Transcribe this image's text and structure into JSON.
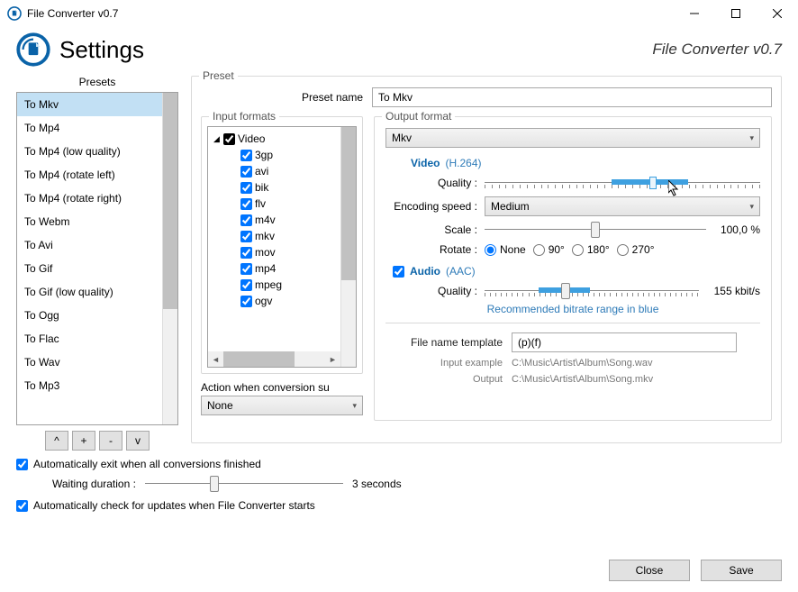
{
  "titlebar": {
    "title": "File Converter v0.7"
  },
  "header": {
    "title": "Settings",
    "subtitle": "File Converter v0.7"
  },
  "presets": {
    "title": "Presets",
    "items": [
      "To Mkv",
      "To Mp4",
      "To Mp4 (low quality)",
      "To Mp4 (rotate left)",
      "To Mp4 (rotate right)",
      "To Webm",
      "To Avi",
      "To Gif",
      "To Gif (low quality)",
      "To Ogg",
      "To Flac",
      "To Wav",
      "To Mp3"
    ],
    "selected": 0,
    "buttons": {
      "up": "^",
      "add": "+",
      "remove": "-",
      "down": "v"
    }
  },
  "preset": {
    "legend": "Preset",
    "name_label": "Preset name",
    "name_value": "To Mkv",
    "input_formats": {
      "legend": "Input formats",
      "group": "Video",
      "items": [
        "3gp",
        "avi",
        "bik",
        "flv",
        "m4v",
        "mkv",
        "mov",
        "mp4",
        "mpeg",
        "ogv"
      ]
    },
    "action": {
      "label": "Action when conversion su",
      "value": "None"
    },
    "output": {
      "legend": "Output format",
      "format": "Mkv",
      "video": {
        "title": "Video",
        "codec": "(H.264)",
        "quality_label": "Quality :",
        "encoding_label": "Encoding speed :",
        "encoding_value": "Medium",
        "scale_label": "Scale :",
        "scale_value": "100,0 %",
        "rotate_label": "Rotate :",
        "rotate_options": [
          "None",
          "90°",
          "180°",
          "270°"
        ],
        "rotate_selected": 0
      },
      "audio": {
        "title": "Audio",
        "codec": "(AAC)",
        "quality_label": "Quality :",
        "quality_value": "155 kbit/s",
        "reco": "Recommended bitrate range in blue"
      },
      "filename": {
        "label": "File name template",
        "value": "(p)(f)",
        "input_example_label": "Input example",
        "input_example_value": "C:\\Music\\Artist\\Album\\Song.wav",
        "output_label": "Output",
        "output_value": "C:\\Music\\Artist\\Album\\Song.mkv"
      }
    }
  },
  "bottom": {
    "auto_exit": "Automatically exit when all conversions finished",
    "waiting_label": "Waiting duration :",
    "waiting_value": "3 seconds",
    "auto_update": "Automatically check for updates when File Converter starts"
  },
  "footer": {
    "close": "Close",
    "save": "Save"
  }
}
